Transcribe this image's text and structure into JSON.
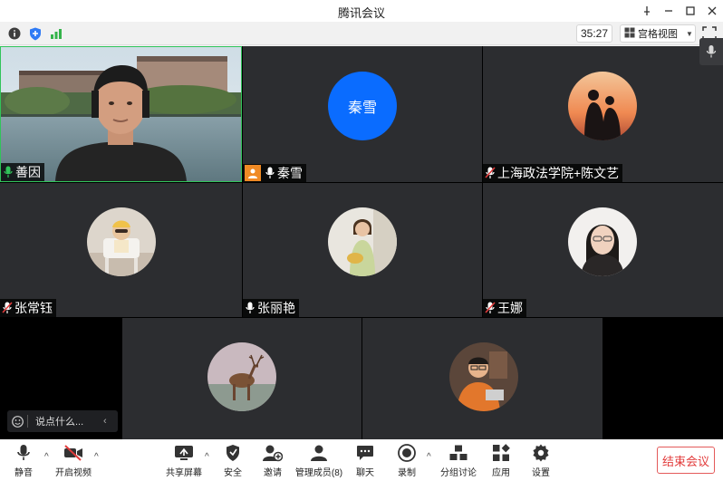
{
  "window": {
    "title": "腾讯会议"
  },
  "status": {
    "timer": "35:27",
    "view_label": "宫格视图"
  },
  "participants": [
    {
      "name": "善因"
    },
    {
      "name": "秦雪",
      "avatar_text": "秦雪"
    },
    {
      "name": "上海政法学院+陈文艺"
    },
    {
      "name": "张常钰"
    },
    {
      "name": "张丽艳"
    },
    {
      "name": "王娜"
    }
  ],
  "chat": {
    "placeholder": "说点什么..."
  },
  "toolbar": {
    "mute": "静音",
    "video": "开启视频",
    "share": "共享屏幕",
    "security": "安全",
    "invite": "邀请",
    "members": "管理成员(8)",
    "chat": "聊天",
    "record": "录制",
    "breakout": "分组讨论",
    "apps": "应用",
    "settings": "设置",
    "end": "结束会议"
  },
  "colors": {
    "accent": "#0a6cff",
    "active_border": "#31c45a",
    "end": "#e23b3b"
  }
}
